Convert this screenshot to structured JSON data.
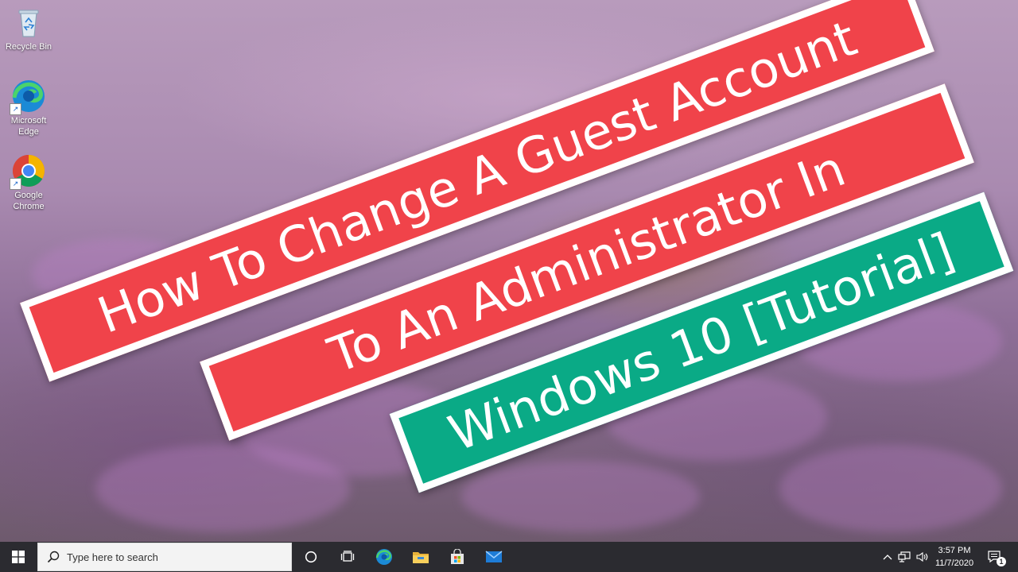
{
  "desktop": {
    "icons": [
      {
        "label": "Recycle Bin",
        "icon": "recycle-bin-icon"
      },
      {
        "label": "Microsoft Edge",
        "icon": "edge-icon"
      },
      {
        "label": "Google Chrome",
        "icon": "chrome-icon"
      }
    ]
  },
  "banners": [
    {
      "text": "How To Change A Guest Account",
      "color": "#f0434a"
    },
    {
      "text": "To An Administrator In",
      "color": "#f0434a"
    },
    {
      "text": "Windows 10 [Tutorial]",
      "color": "#0aaa86"
    }
  ],
  "taskbar": {
    "start_icon": "windows-logo-icon",
    "search_placeholder": "Type here to search",
    "pinned": [
      "cortana-icon",
      "task-view-icon",
      "edge-icon",
      "file-explorer-icon",
      "microsoft-store-icon",
      "mail-icon"
    ],
    "tray_icons": [
      "chevron-up-icon",
      "network-icon",
      "volume-icon"
    ],
    "time": "3:57 PM",
    "date": "11/7/2020",
    "notification_count": "1",
    "accent": "#2b2b30"
  }
}
